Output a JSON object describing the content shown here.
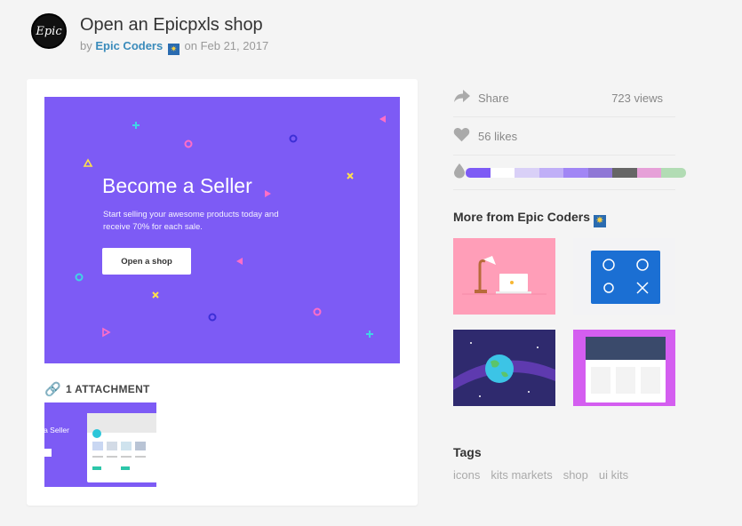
{
  "header": {
    "title": "Open an Epicpxls shop",
    "by_label": "by",
    "author": "Epic Coders",
    "on_label": "on",
    "date": "Feb 21, 2017",
    "avatar_text": "Epic"
  },
  "shot": {
    "hero_title": "Become a Seller",
    "hero_sub": "Start selling your awesome products today and receive 70% for each sale.",
    "cta_label": "Open a shop",
    "bg_color": "#7d5bf5"
  },
  "attachments": {
    "heading": "1 ATTACHMENT",
    "thumb_text": "e a Seller"
  },
  "stats": {
    "share_label": "Share",
    "views": "723 views",
    "likes": "56 likes"
  },
  "palette": [
    "#7d5bf5",
    "#ffffff",
    "#d9d0f7",
    "#c0aff7",
    "#a186f5",
    "#8f77d6",
    "#666666",
    "#e6a0d8",
    "#b2dcb4"
  ],
  "more_from": {
    "heading": "More from Epic Coders",
    "items": [
      {
        "name": "lamp-laptop-shot",
        "bg": "#ff9eb8"
      },
      {
        "name": "icons-shot",
        "bg": "#f3f3f5"
      },
      {
        "name": "planet-shot",
        "bg": "#2f2a6e"
      },
      {
        "name": "ui-kit-shot",
        "bg": "#d45ef0"
      }
    ]
  },
  "tags": {
    "heading": "Tags",
    "items": [
      "icons",
      "kits markets",
      "shop",
      "ui kits"
    ]
  }
}
